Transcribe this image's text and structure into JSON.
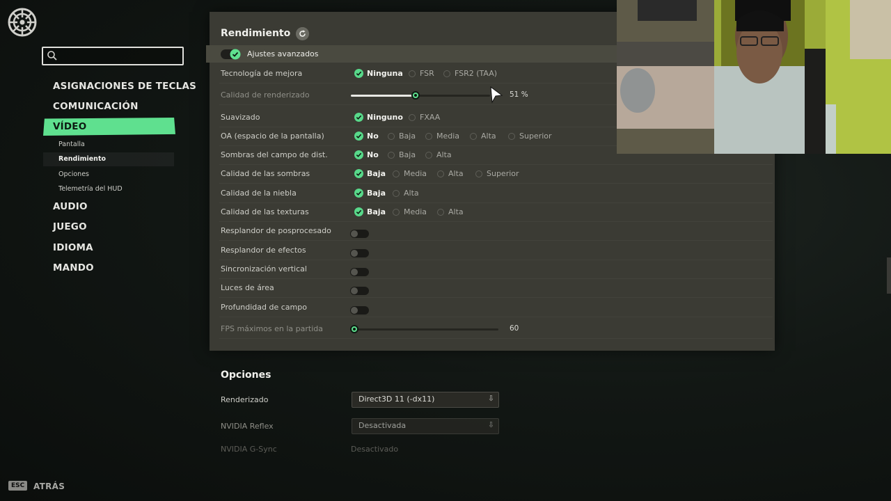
{
  "nav": {
    "search": {
      "value": "",
      "placeholder": ""
    },
    "items": [
      {
        "label": "ASIGNACIONES DE TECLAS"
      },
      {
        "label": "COMUNICACIÓN"
      },
      {
        "label": "VÍDEO",
        "active": true
      },
      {
        "label": "AUDIO"
      },
      {
        "label": "JUEGO"
      },
      {
        "label": "IDIOMA"
      },
      {
        "label": "MANDO"
      }
    ],
    "subitems": [
      {
        "label": "Pantalla"
      },
      {
        "label": "Rendimiento",
        "active": true
      },
      {
        "label": "Opciones"
      },
      {
        "label": "Telemetría del HUD"
      }
    ]
  },
  "footer": {
    "key": "ESC",
    "label": "ATRÁS"
  },
  "rendimiento": {
    "title": "Rendimiento",
    "advanced_label": "Ajustes avanzados",
    "advanced_on": true,
    "settings": [
      {
        "label": "Tecnología de mejora",
        "options": [
          "Ninguna",
          "FSR",
          "FSR2 (TAA)"
        ],
        "selected": 0
      },
      {
        "label": "Calidad de renderizado",
        "slider": 0.51,
        "value_text": "51 %",
        "dim": true
      },
      {
        "label": "Suavizado",
        "options": [
          "Ninguno",
          "FXAA"
        ],
        "selected": 0
      },
      {
        "label": "OA (espacio de la pantalla)",
        "options": [
          "No",
          "Baja",
          "Media",
          "Alta",
          "Superior"
        ],
        "selected": 0
      },
      {
        "label": "Sombras del campo de dist.",
        "options": [
          "No",
          "Baja",
          "Alta"
        ],
        "selected": 0
      },
      {
        "label": "Calidad de las sombras",
        "options": [
          "Baja",
          "Media",
          "Alta",
          "Superior"
        ],
        "selected": 0
      },
      {
        "label": "Calidad de la niebla",
        "options": [
          "Baja",
          "Alta"
        ],
        "selected": 0
      },
      {
        "label": "Calidad de las texturas",
        "options": [
          "Baja",
          "Media",
          "Alta"
        ],
        "selected": 0
      },
      {
        "label": "Resplandor de posprocesado",
        "toggle": false
      },
      {
        "label": "Resplandor de efectos",
        "toggle": false
      },
      {
        "label": "Sincronización vertical",
        "toggle": false
      },
      {
        "label": "Luces de área",
        "toggle": false
      },
      {
        "label": "Profundidad de campo",
        "toggle": false
      },
      {
        "label": "FPS máximos en la partida",
        "slider": 0.0,
        "value_text": "60",
        "dim": true
      }
    ]
  },
  "opciones": {
    "title": "Opciones",
    "rows": [
      {
        "label": "Renderizado",
        "value": "Direct3D 11 (-dx11)",
        "dropdown": true
      },
      {
        "label": "NVIDIA Reflex",
        "value": "Desactivada",
        "dropdown": true,
        "dim": true
      },
      {
        "label": "NVIDIA G-Sync",
        "value": "Desactivado",
        "dropdown": false,
        "dim": true
      }
    ]
  },
  "colors": {
    "accent": "#5fe08f",
    "panel": "#3b3b34",
    "background": "#121714"
  },
  "icons": [
    "gear-logo-icon",
    "search-icon",
    "reset-icon",
    "check-icon",
    "chevron-down-icon",
    "mouse-cursor-icon"
  ]
}
